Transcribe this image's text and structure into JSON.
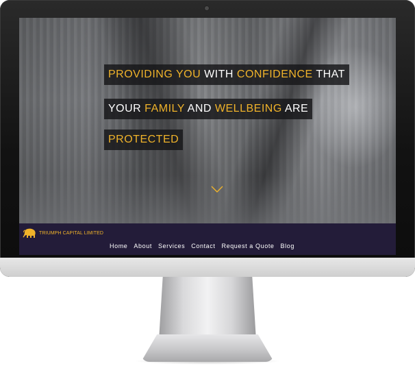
{
  "brand": {
    "logo_text": "TRIUMPH CAPITAL LIMITED",
    "logo_icon": "elephant-icon",
    "accent_color": "#f0b32a",
    "nav_bg_color": "#231c39"
  },
  "hero": {
    "line1": {
      "w1": "PROVIDING YOU",
      "w2": " WITH ",
      "w3": "CONFIDENCE",
      "w4": " THAT"
    },
    "line2": {
      "w1": "YOUR ",
      "w2": "FAMILY",
      "w3": " AND ",
      "w4": "WELLBEING",
      "w5": " ARE"
    },
    "line3": {
      "w1": "PROTECTED"
    },
    "scroll_icon": "chevron-down-icon"
  },
  "nav": {
    "items": [
      {
        "label": "Home"
      },
      {
        "label": "About"
      },
      {
        "label": "Services"
      },
      {
        "label": "Contact"
      },
      {
        "label": "Request a Quote"
      },
      {
        "label": "Blog"
      }
    ]
  }
}
